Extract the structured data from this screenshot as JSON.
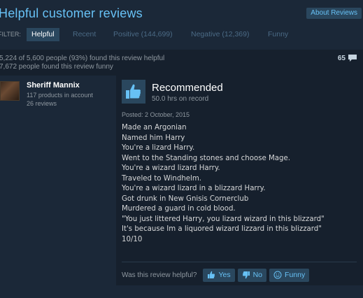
{
  "header": {
    "title": "Helpful customer reviews",
    "about_label": "About Reviews"
  },
  "filters": {
    "label": "FILTER:",
    "tabs": [
      {
        "label": "Helpful",
        "active": true
      },
      {
        "label": "Recent",
        "active": false
      },
      {
        "label": "Positive (144,699)",
        "active": false
      },
      {
        "label": "Negative (12,369)",
        "active": false
      },
      {
        "label": "Funny",
        "active": false
      }
    ]
  },
  "summary": {
    "helpful_line": "5,224 of 5,600 people (93%) found this review helpful",
    "funny_line": "7,672 people found this review funny",
    "comment_count": "65",
    "comment_icon": "speech-bubble-icon"
  },
  "reviewer": {
    "name": "Sheriff Mannix",
    "products": "117 products in account",
    "reviews": "26 reviews"
  },
  "review": {
    "verdict": "Recommended",
    "verdict_icon": "thumbs-up-icon",
    "hours": "50.0 hrs on record",
    "posted": "Posted: 2 October, 2015",
    "lines": [
      "Made an Argonian",
      "Named him Harry",
      "You're a lizard Harry.",
      "Went to the Standing stones and choose Mage.",
      "You're a wizard lizard Harry.",
      "Traveled to Windhelm.",
      "You're a wizard lizard in a blizzard Harry.",
      "Got drunk in New Gnisis Cornerclub",
      "Murdered a guard in cold blood.",
      "\"You just littered Harry, you lizard wizard in this blizzard\"",
      "It's because Im a liquored wizard lizzard in this blizzard\"",
      "10/10"
    ]
  },
  "helpful_prompt": {
    "question": "Was this review helpful?",
    "yes_label": "Yes",
    "no_label": "No",
    "funny_label": "Funny"
  },
  "colors": {
    "background": "#1b2838",
    "panel": "#16202d",
    "accent": "#67c1f5",
    "button": "#2a475e"
  }
}
